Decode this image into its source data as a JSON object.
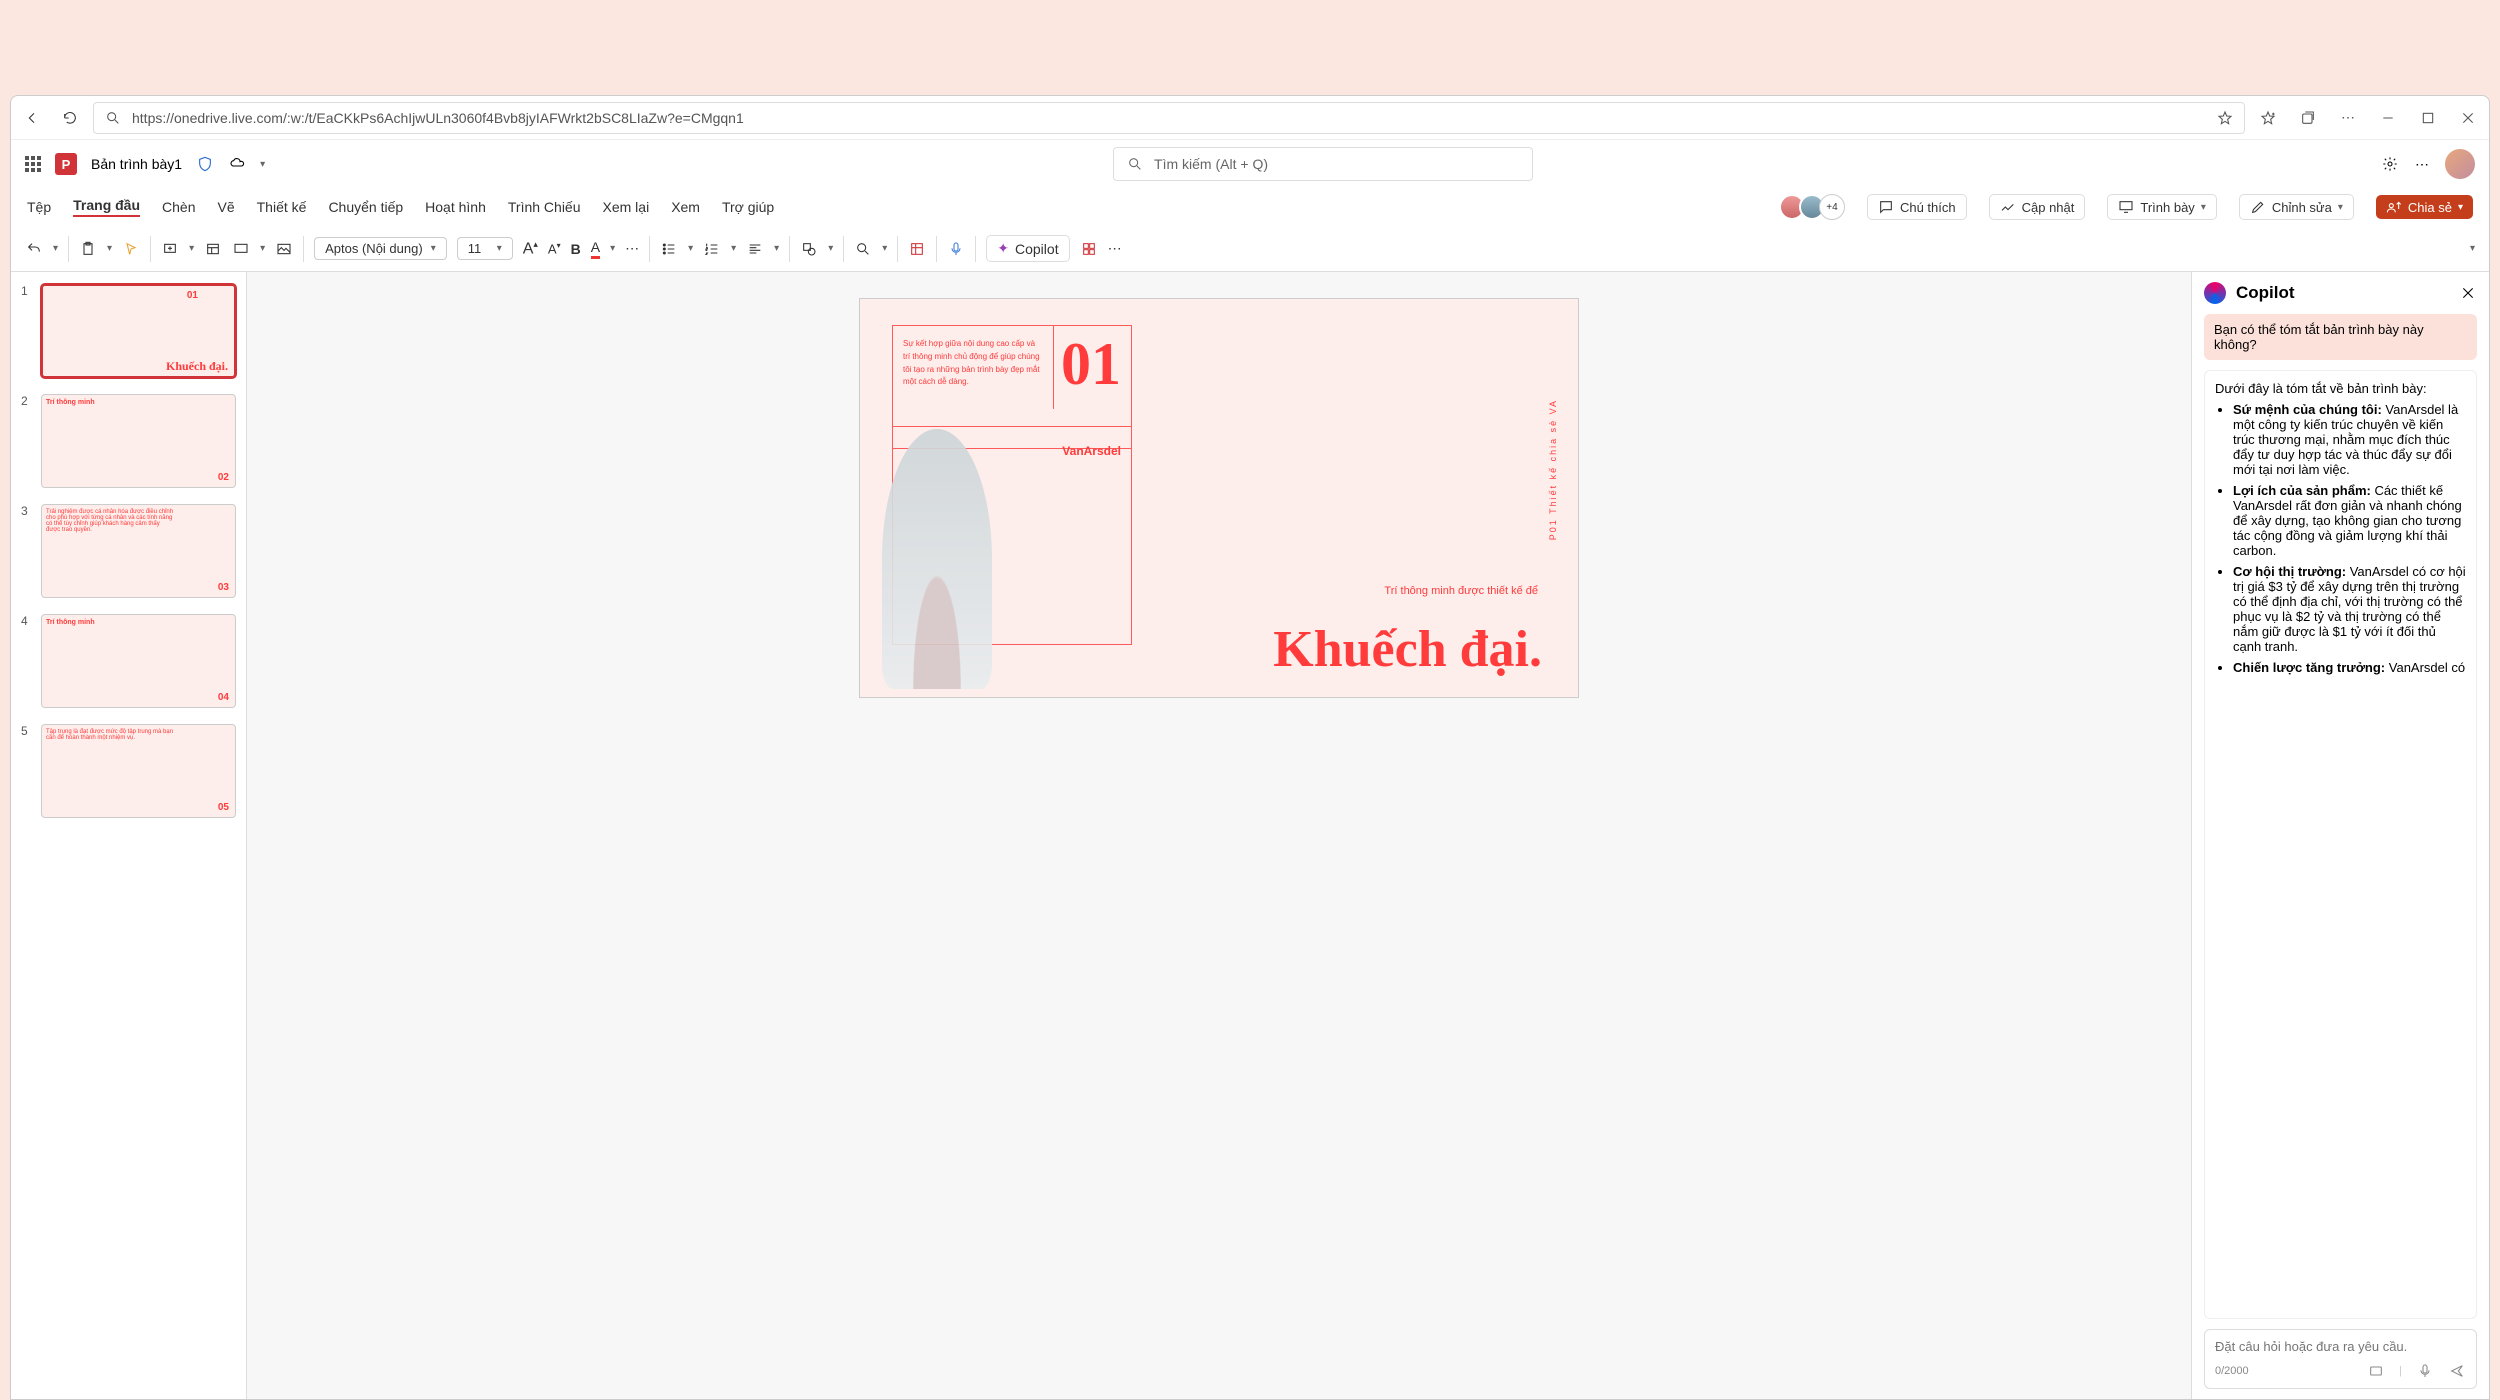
{
  "browser": {
    "url": "https://onedrive.live.com/:w:/t/EaCKkPs6AchIjwULn3060f4Bvb8jyIAFWrkt2bSC8LIaZw?e=CMgqn1"
  },
  "app": {
    "title": "Bản trình bày1",
    "search_placeholder": "Tìm kiếm (Alt + Q)"
  },
  "tabs": {
    "t0": "Tệp",
    "t1": "Trang đầu",
    "t2": "Chèn",
    "t3": "Vẽ",
    "t4": "Thiết kế",
    "t5": "Chuyển tiếp",
    "t6": "Hoạt hình",
    "t7": "Trình Chiếu",
    "t8": "Xem lại",
    "t9": "Xem",
    "t10": "Trợ giúp"
  },
  "actions": {
    "collab_plus": "+4",
    "comment": "Chú thích",
    "catchup": "Cập nhật",
    "present": "Trình bày",
    "edit": "Chỉnh sửa",
    "share": "Chia sẻ"
  },
  "toolbar": {
    "font": "Aptos (Nội dung)",
    "size": "11",
    "copilot": "Copilot"
  },
  "thumbs": {
    "s1": {
      "num": "01",
      "title": "Khuếch đại."
    },
    "s2": {
      "num": "02",
      "title": "Trí thông minh"
    },
    "s3": {
      "num": "03",
      "text": "Trải nghiệm được cá nhân hóa được điều chỉnh cho phù hợp với từng cá nhân và các tính năng có thể tùy chỉnh giúp khách hàng cảm thấy được trao quyền."
    },
    "s4": {
      "num": "04",
      "title": "Trí thông minh"
    },
    "s5": {
      "num": "05",
      "text": "Tập trung là đạt được mức độ tập trung mà bạn cần để hoàn thành một nhiệm vụ."
    }
  },
  "slide": {
    "box_text": "Sự kết hợp giữa nội dung cao cấp và trí thông minh chủ động để giúp chúng tôi tạo ra những bản trình bày đẹp mắt một cách dễ dàng.",
    "num": "01",
    "brand": "VanArsdel",
    "sidetxt": "P01   Thiết kế chia sẻ VA",
    "subtitle": "Trí thông minh được thiết kế để",
    "headline": "Khuếch đại."
  },
  "copilot": {
    "title": "Copilot",
    "user_msg": "Bạn có thể tóm tắt bản trình bày này không?",
    "intro": "Dưới đây là tóm tắt về bản trình bày:",
    "b1_h": "Sứ mệnh của chúng tôi:",
    "b1_t": " VanArsdel là một công ty kiến trúc chuyên về kiến trúc thương mại, nhằm mục đích thúc đẩy tư duy hợp tác và thúc đẩy sự đổi mới tại nơi làm việc.",
    "b2_h": "Lợi ích của sản phẩm:",
    "b2_t": " Các thiết kế VanArsdel rất đơn giản và nhanh chóng để xây dựng, tạo không gian cho tương tác cộng đồng và giảm lượng khí thải carbon.",
    "b3_h": "Cơ hội thị trường:",
    "b3_t": " VanArsdel có cơ hội trị giá $3 tỷ để xây dựng trên thị trường có thể định địa chỉ, với thị trường có thể phục vụ là $2 tỷ và thị trường có thể nắm giữ được là $1 tỷ với ít đối thủ cạnh tranh.",
    "b4_h": "Chiến lược tăng trưởng:",
    "b4_t": " VanArsdel có",
    "placeholder": "Đặt câu hỏi hoặc đưa ra yêu cầu.",
    "counter": "0/2000"
  }
}
